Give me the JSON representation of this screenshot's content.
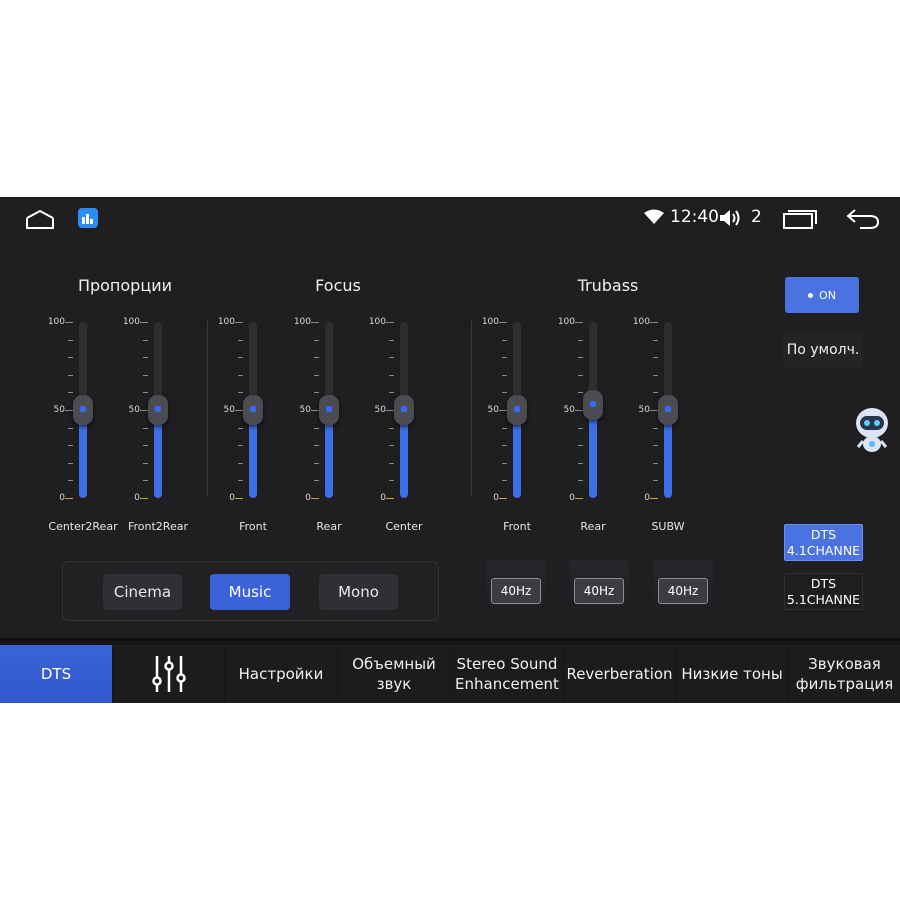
{
  "status_bar": {
    "time": "12:40",
    "volume_level": "2",
    "icons": [
      "home-icon",
      "app-icon",
      "wifi-icon",
      "volume-icon",
      "recents-icon",
      "back-icon"
    ]
  },
  "groups": {
    "proportions_title": "Пропорции",
    "focus_title": "Focus",
    "trubass_title": "Trubass"
  },
  "scale_labels": {
    "max": "100",
    "mid": "50",
    "min": "0"
  },
  "sliders": [
    {
      "name": "Center2Rear",
      "value": 50
    },
    {
      "name": "Front2Rear",
      "value": 50
    },
    {
      "name": "Front",
      "value": 50
    },
    {
      "name": "Rear",
      "value": 50
    },
    {
      "name": "Center",
      "value": 50
    },
    {
      "name": "Front",
      "value": 50
    },
    {
      "name": "Rear",
      "value": 53
    },
    {
      "name": "SUBW",
      "value": 50
    }
  ],
  "modes": {
    "cinema": "Cinema",
    "music": "Music",
    "mono": "Mono",
    "selected": "Music"
  },
  "trubass_freq": [
    "40Hz",
    "40Hz",
    "40Hz"
  ],
  "right_panel": {
    "on_label": "ON",
    "default_label": "По умолч.",
    "dts41": [
      "DTS",
      "4.1CHANNE"
    ],
    "dts51": [
      "DTS",
      "5.1CHANNE"
    ]
  },
  "tabs": [
    {
      "label": "DTS",
      "active": true
    },
    {
      "label": "",
      "icon": "equalizer-icon"
    },
    {
      "label": "Настройки"
    },
    {
      "label": "Объемный звук"
    },
    {
      "label": "Stereo Sound Enhancement"
    },
    {
      "label": "Reverberation"
    },
    {
      "label": "Низкие тоны"
    },
    {
      "label": "Звуковая фильтрация"
    }
  ],
  "colors": {
    "accent": "#3c62d8",
    "background": "#1f1f21",
    "slider_fill": "#3f6fe6"
  }
}
